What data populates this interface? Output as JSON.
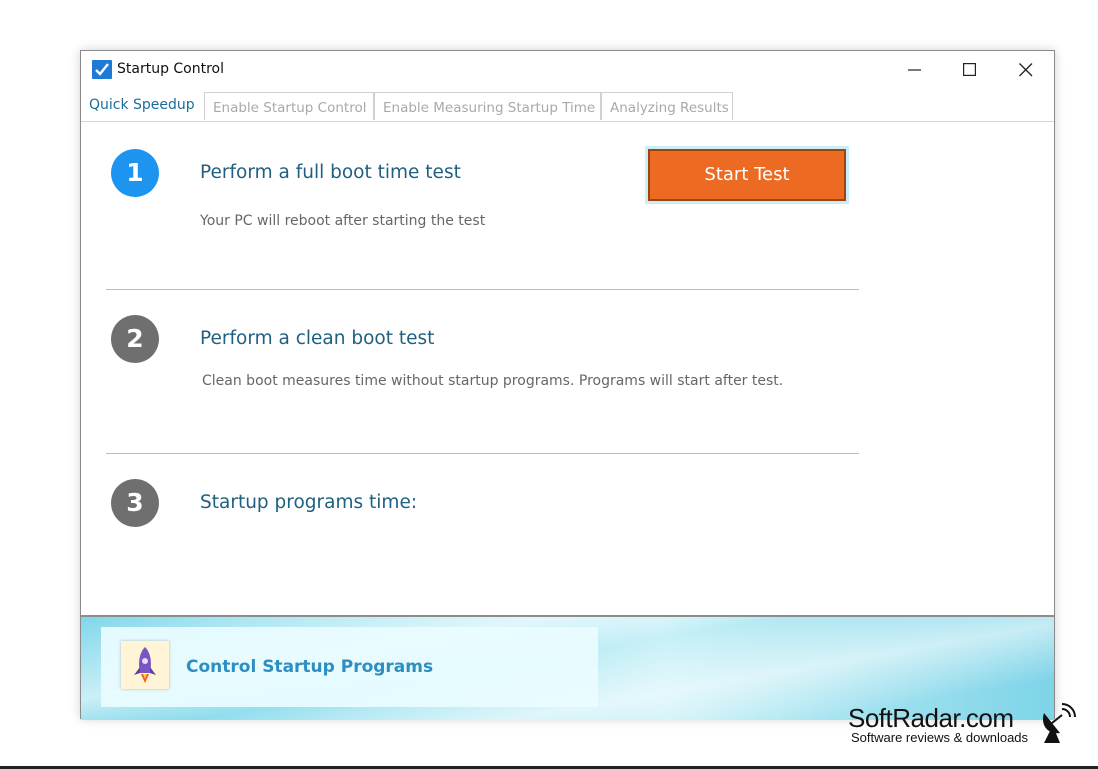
{
  "window": {
    "title": "Startup Control",
    "icon": "checkmark-icon",
    "controls": {
      "minimize": "minimize-icon",
      "maximize": "maximize-icon",
      "close": "close-icon"
    }
  },
  "tabs": [
    {
      "label": "Quick Speedup",
      "active": true
    },
    {
      "label": "Enable Startup Control",
      "active": false
    },
    {
      "label": "Enable Measuring Startup Time",
      "active": false
    },
    {
      "label": "Analyzing Results",
      "active": false
    }
  ],
  "steps": [
    {
      "number": "1",
      "title": "Perform a full boot time test",
      "description": "Your PC will reboot after starting the test",
      "color": "#1c94f0"
    },
    {
      "number": "2",
      "title": "Perform a clean boot test",
      "description": "Clean boot measures time without startup programs. Programs will start after test.",
      "color": "#6f6f6f"
    },
    {
      "number": "3",
      "title": "Startup programs time:",
      "color": "#6f6f6f"
    }
  ],
  "start_button": {
    "label": "Start Test",
    "color": "#ec6a22"
  },
  "footer": {
    "label": "Control Startup Programs",
    "icon": "rocket-icon"
  },
  "watermark": {
    "title": "SoftRadar.com",
    "subtitle": "Software reviews & downloads",
    "icon": "satellite-dish-icon"
  }
}
